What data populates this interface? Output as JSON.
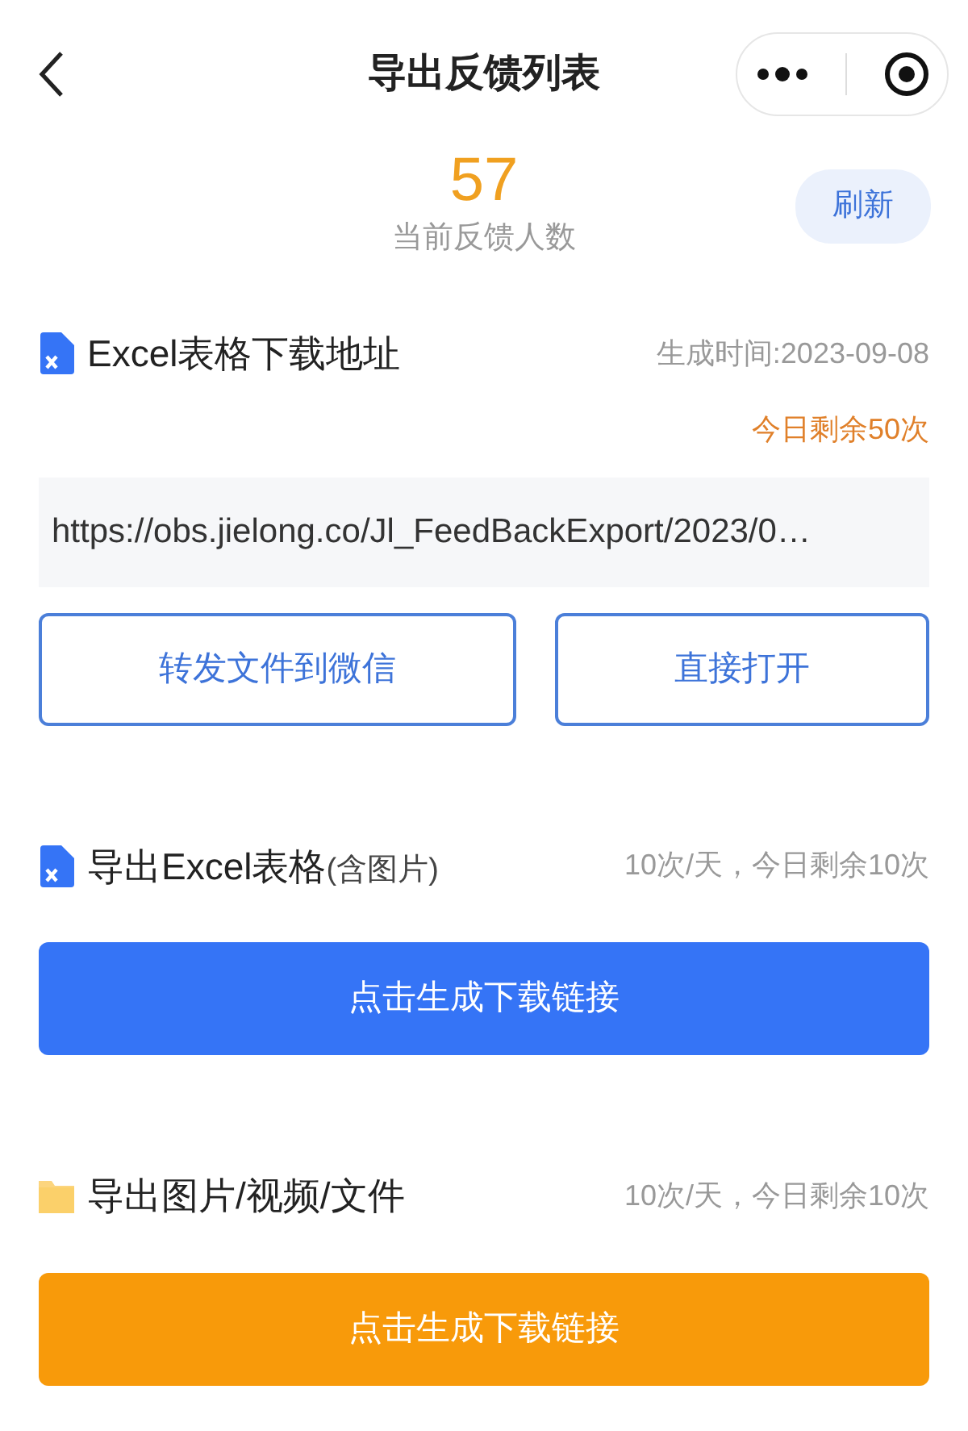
{
  "nav": {
    "title": "导出反馈列表"
  },
  "summary": {
    "count": "57",
    "label": "当前反馈人数",
    "refresh": "刷新"
  },
  "download": {
    "title": "Excel表格下载地址",
    "generated": "生成时间:2023-09-08",
    "remaining": "今日剩余50次",
    "url": "https://obs.jielong.co/Jl_FeedBackExport/2023/0…",
    "buttons": [
      "转发文件到微信",
      "直接打开"
    ]
  },
  "exports": [
    {
      "kind": "excel",
      "title": "导出Excel表格",
      "note": "(含图片)",
      "quota": "10次/天，今日剩余10次",
      "button": "点击生成下载链接"
    },
    {
      "kind": "folder",
      "title": "导出图片/视频/文件",
      "quota": "10次/天，今日剩余10次",
      "button": "点击生成下载链接"
    }
  ]
}
